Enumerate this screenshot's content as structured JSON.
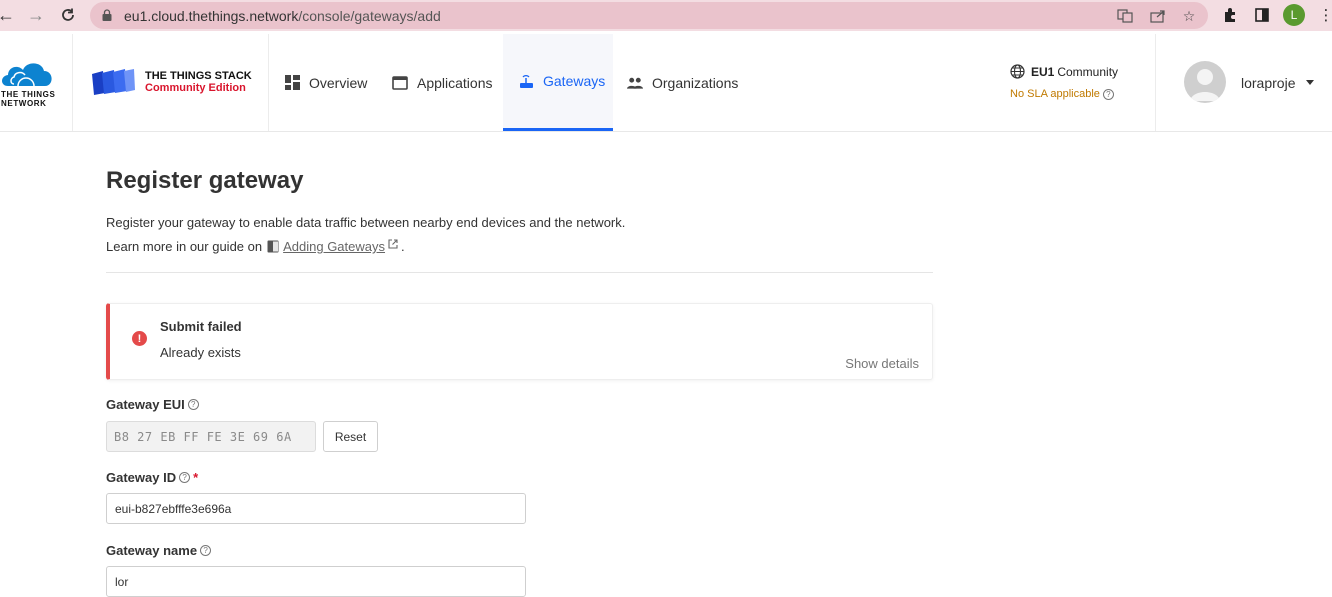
{
  "browser": {
    "url_host": "eu1.cloud.thethings.network",
    "url_path": "/console/gateways/add",
    "profile_initial": "L"
  },
  "header": {
    "ttn_logo_text_line1": "THE THINGS",
    "ttn_logo_text_line2": "NETWORK",
    "tts_title": "THE THINGS STACK",
    "tts_subtitle": "Community Edition",
    "nav": [
      {
        "label": "Overview"
      },
      {
        "label": "Applications"
      },
      {
        "label": "Gateways"
      },
      {
        "label": "Organizations"
      }
    ],
    "region_code": "EU1",
    "region_name": "Community",
    "sla_text": "No SLA applicable",
    "username": "loraproje"
  },
  "main": {
    "title": "Register gateway",
    "description": "Register your gateway to enable data traffic between nearby end devices and the network.",
    "learn_prefix": "Learn more in our guide on",
    "learn_link": "Adding Gateways",
    "learn_suffix": "."
  },
  "alert": {
    "title": "Submit failed",
    "message": "Already exists",
    "details_label": "Show details"
  },
  "form": {
    "eui_label": "Gateway EUI",
    "eui_value": "B8 27 EB FF FE 3E 69 6A",
    "reset_label": "Reset",
    "id_label": "Gateway ID",
    "id_required": "*",
    "id_value": "eui-b827ebfffe3e696a",
    "name_label": "Gateway name",
    "name_value": "lor"
  },
  "colors": {
    "accent": "#1a65f5",
    "brand_red": "#d9152d",
    "error": "#e44a4a",
    "sla": "#c07a00"
  }
}
